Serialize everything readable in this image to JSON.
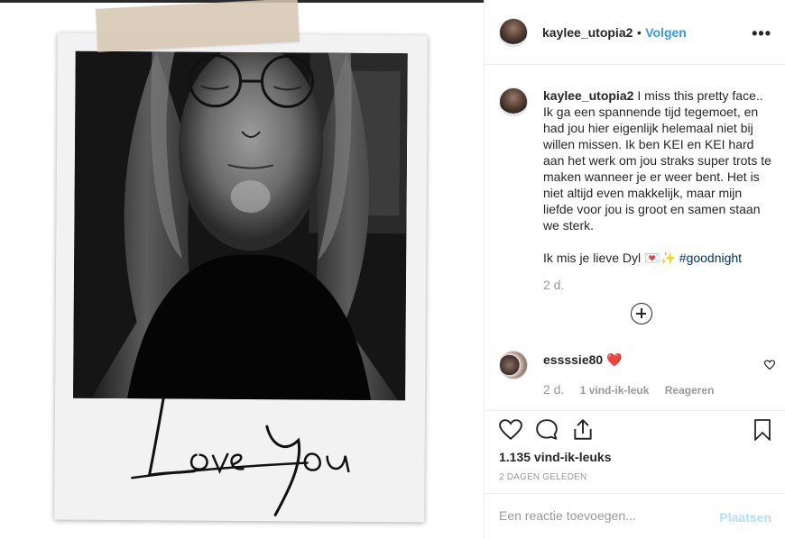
{
  "post": {
    "image_caption_text": "Love You"
  },
  "header": {
    "username": "kaylee_utopia2",
    "separator": "•",
    "follow_label": "Volgen",
    "more_icon": "more-horizontal-icon"
  },
  "caption": {
    "username": "kaylee_utopia2",
    "text_main": "I miss this pretty face.. Ik ga een spannende tijd tegemoet, en had jou hier eigenlijk helemaal niet bij willen missen. Ik ben KEI en KEI hard aan het werk om jou straks super trots te maken wanneer je er weer bent. Het is niet altijd even makkelijk, maar mijn liefde voor jou is groot en samen staan we sterk.",
    "text_second": "Ik mis je lieve Dyl 💌✨",
    "hashtag": "#goodnight",
    "time": "2 d."
  },
  "comments": [
    {
      "username": "essssie80",
      "text": "❤️",
      "time": "2 d.",
      "likes": "1 vind-ik-leuk",
      "reply_label": "Reageren"
    }
  ],
  "actions": {
    "like_icon": "heart-outline-icon",
    "comment_icon": "comment-bubble-icon",
    "share_icon": "share-upload-icon",
    "save_icon": "bookmark-icon",
    "likes_count": "1.135 vind-ik-leuks",
    "posted_ago": "2 DAGEN GELEDEN"
  },
  "add_comment": {
    "placeholder": "Een reactie toevoegen...",
    "post_label": "Plaatsen"
  },
  "colors": {
    "link": "#3897f0",
    "hashtag": "#003569",
    "secondary_text": "#999999",
    "post_disabled": "#b2dffc",
    "like_heart": "#ed4956"
  }
}
